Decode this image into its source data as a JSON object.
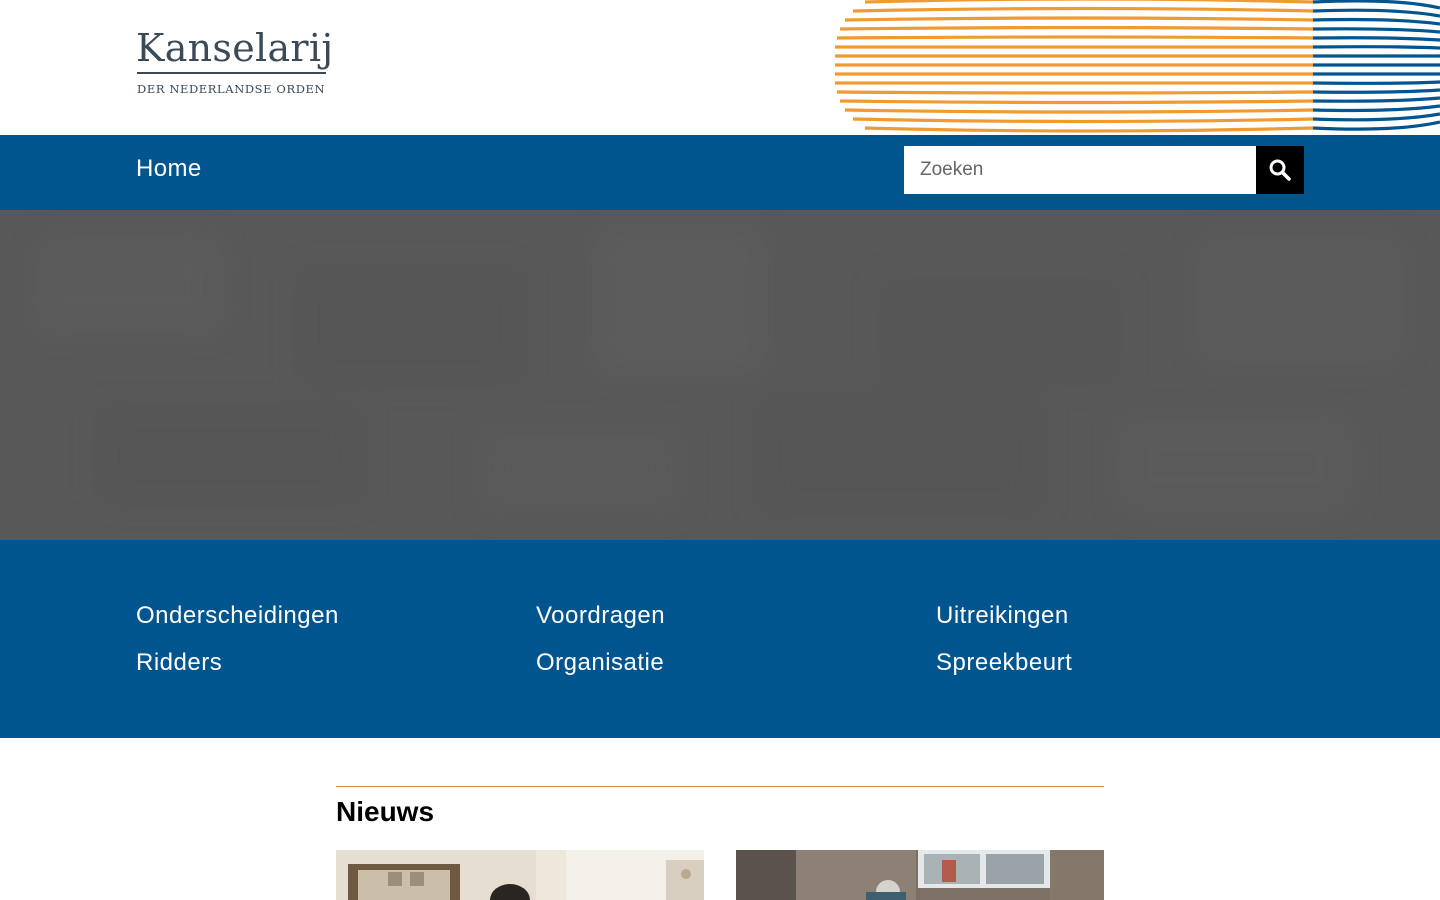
{
  "brand": {
    "title": "Kanselarij",
    "subtitle": "DER NEDERLANDSE ORDEN",
    "colors": {
      "primary_blue": "#01558f",
      "accent_orange": "#f09a32",
      "logo_gray": "#3a4a57",
      "hero_gray": "#585858",
      "news_rule": "#c5913d"
    }
  },
  "nav": {
    "home_label": "Home"
  },
  "search": {
    "placeholder": "Zoeken",
    "button_icon": "search-icon"
  },
  "quick_links": [
    {
      "label": "Onderscheidingen"
    },
    {
      "label": "Voordragen"
    },
    {
      "label": "Uitreikingen"
    },
    {
      "label": "Ridders"
    },
    {
      "label": "Organisatie"
    },
    {
      "label": "Spreekbeurt"
    }
  ],
  "news": {
    "heading": "Nieuws",
    "cards": [
      {
        "image_icon": "news-photo-icon"
      },
      {
        "image_icon": "news-photo-icon"
      }
    ]
  }
}
